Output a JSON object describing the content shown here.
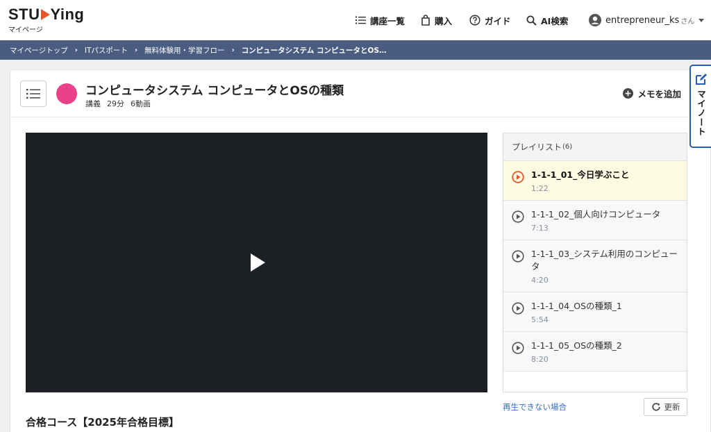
{
  "brand": {
    "logo_pre": "STU",
    "logo_post": "Ying",
    "logo_sub": "マイページ"
  },
  "nav": {
    "courses": "講座一覧",
    "buy": "購入",
    "guide": "ガイド",
    "ai": "AI検索",
    "user": "entrepreneur_ks",
    "user_suffix": "さん"
  },
  "breadcrumb": {
    "items": [
      "マイページトップ",
      "ITパスポート",
      "無料体験用・学習フロー",
      "コンピュータシステム コンピュータとOS…"
    ],
    "separator": "›"
  },
  "lesson": {
    "title": "コンピュータシステム コンピュータとOSの種類",
    "type": "講義",
    "duration": "29分",
    "videos": "6動画",
    "memo_label": "メモを追加"
  },
  "playlist": {
    "label": "プレイリスト",
    "count": "(6)",
    "items": [
      {
        "title": "1-1-1_01_今日学ぶこと",
        "duration": "1:22",
        "active": true
      },
      {
        "title": "1-1-1_02_個人向けコンピュータ",
        "duration": "7:13",
        "active": false
      },
      {
        "title": "1-1-1_03_システム利用のコンピュータ",
        "duration": "4:20",
        "active": false
      },
      {
        "title": "1-1-1_04_OSの種類_1",
        "duration": "5:54",
        "active": false
      },
      {
        "title": "1-1-1_05_OSの種類_2",
        "duration": "8:20",
        "active": false
      }
    ]
  },
  "player": {
    "cannot_play": "再生できない場合",
    "refresh": "更新"
  },
  "course": {
    "title": "合格コース【2025年合格目標】"
  },
  "mynote": {
    "label": "マイノート"
  },
  "colors": {
    "accent": "#e8532b",
    "breadcrumb_bg": "#4a5d80",
    "lesson_dot": "#e9418a",
    "link": "#2f6fc9",
    "mynote_border": "#2a5bb8",
    "active_item_bg": "#fdfbe2"
  }
}
